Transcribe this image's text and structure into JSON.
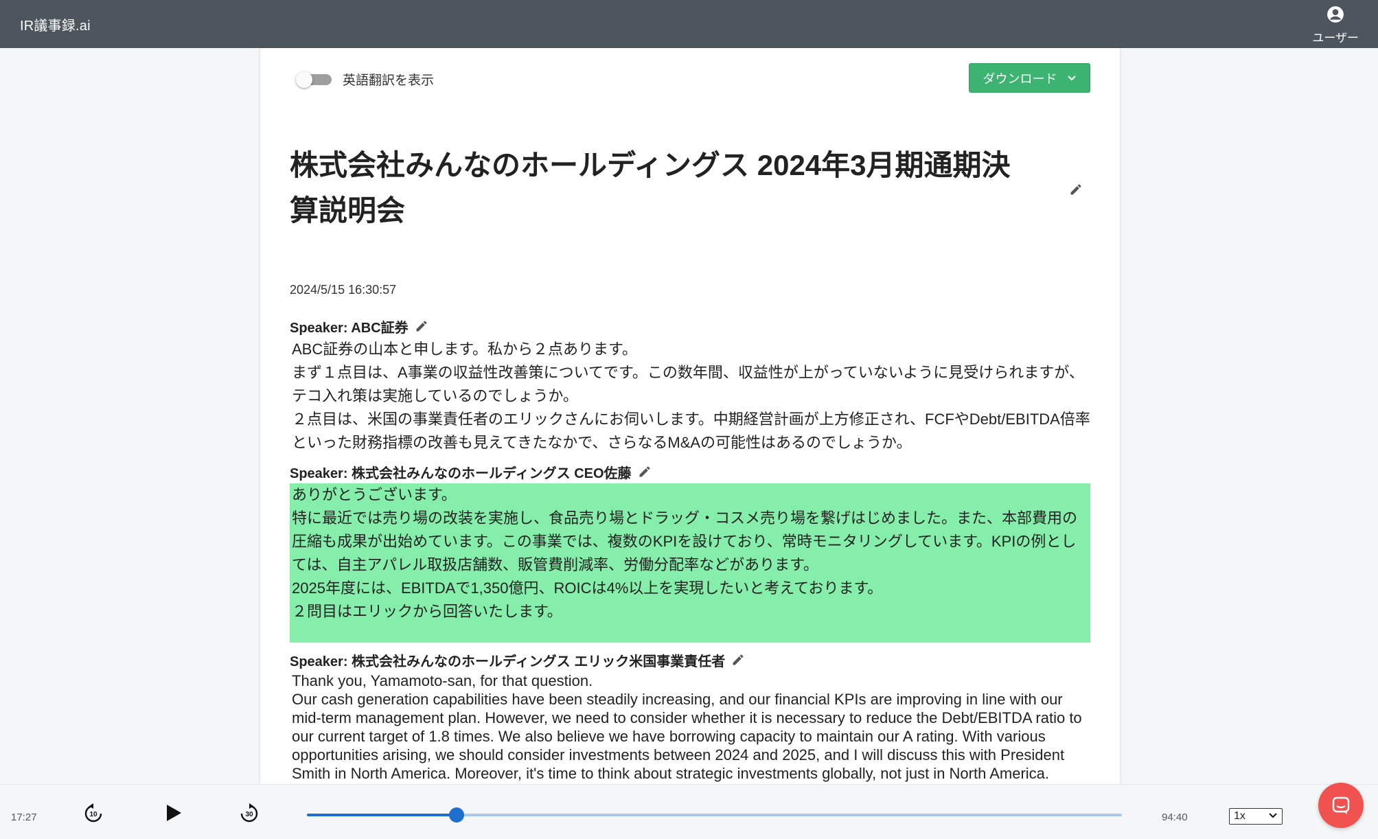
{
  "app": {
    "brand": "IR議事録.ai"
  },
  "header": {
    "user_label": "ユーザー"
  },
  "controls": {
    "translate_toggle_label": "英語翻訳を表示",
    "translate_toggle_on": false,
    "download_label": "ダウンロード"
  },
  "doc": {
    "title": "株式会社みんなのホールディングス 2024年3月期通期決算説明会",
    "datetime": "2024/5/15 16:30:57"
  },
  "transcript": [
    {
      "speaker": "Speaker: ABC証券",
      "text": "ABC証券の山本と申します。私から２点あります。\nまず１点目は、A事業の収益性改善策についてです。この数年間、収益性が上がっていないように見受けられますが、テコ入れ策は実施しているのでしょうか。\n２点目は、米国の事業責任者のエリックさんにお伺いします。中期経営計画が上方修正され、FCFやDebt/EBITDA倍率といった財務指標の改善も見えてきたなかで、さらなるM&Aの可能性はあるのでしょうか。",
      "highlighted": false
    },
    {
      "speaker": "Speaker: 株式会社みんなのホールディングス CEO佐藤",
      "text": "ありがとうございます。\n特に最近では売り場の改装を実施し、食品売り場とドラッグ・コスメ売り場を繋げはじめました。また、本部費用の圧縮も成果が出始めています。この事業では、複数のKPIを設けており、常時モニタリングしています。KPIの例としては、自主アパレル取扱店舗数、販管費削減率、労働分配率などがあります。\n2025年度には、EBITDAで1,350億円、ROICは4%以上を実現したいと考えております。\n２問目はエリックから回答いたします。",
      "highlighted": true
    },
    {
      "speaker": "Speaker: 株式会社みんなのホールディングス エリック米国事業責任者",
      "text": "Thank you, Yamamoto-san, for that question.\nOur cash generation capabilities have been steadily increasing, and our financial KPIs are improving in line with our mid-term management plan. However, we need to consider whether it is necessary to reduce the Debt/EBITDA ratio to our current target of 1.8 times. We also believe we have borrowing capacity to maintain our A rating. With various opportunities arising, we should consider investments between 2024 and 2025, and I will discuss this with President Smith in North America. Moreover, it's time to think about strategic investments globally, not just in North America.",
      "highlighted": false
    }
  ],
  "player": {
    "current_time": "17:27",
    "duration": "94:40",
    "progress": 0.184,
    "skip_back_label": "10",
    "skip_forward_label": "30",
    "speed": "1x"
  },
  "colors": {
    "topbar": "#4d555e",
    "accent_green": "#3cb371",
    "highlight": "#86eeab",
    "seek_fill": "#1f6fd1",
    "chat_fab": "#f0534f"
  }
}
